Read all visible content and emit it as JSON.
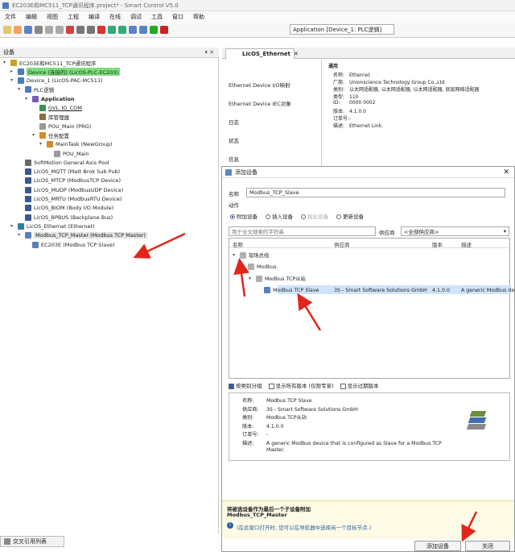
{
  "window": {
    "title": "EC203E和MC511_TCP通讯程序.project* - Smart Control V5.0"
  },
  "menu": [
    "文件",
    "编辑",
    "视图",
    "工程",
    "编译",
    "在线",
    "调试",
    "工具",
    "窗口",
    "帮助"
  ],
  "toolbar": {
    "application_select": "Application [Device_1: PLC逻辑]"
  },
  "left_panel": {
    "header": "设备",
    "bottom_tab": "交叉引用列表",
    "tree": [
      {
        "label": "EC203E和MC511_TCP通讯程序",
        "indent": 0,
        "icon": "project-icon",
        "exp": "▾"
      },
      {
        "label": "Device (连接的) (LicOS-PLC-EC203)",
        "indent": 1,
        "icon": "device-icon",
        "exp": "▸",
        "hl": "green"
      },
      {
        "label": "Device_1 (LicOS-PAC-MC511)",
        "indent": 1,
        "icon": "device-icon",
        "exp": "▾"
      },
      {
        "label": "PLC逻辑",
        "indent": 2,
        "icon": "plc-logic-icon",
        "exp": "▾"
      },
      {
        "label": "Application",
        "indent": 3,
        "icon": "application-icon",
        "exp": "▾",
        "bold": true
      },
      {
        "label": "GVL_IO_COM",
        "indent": 4,
        "icon": "gvl-icon",
        "exp": "",
        "underline": true
      },
      {
        "label": "库管理器",
        "indent": 4,
        "icon": "library-icon",
        "exp": ""
      },
      {
        "label": "POU_Main (PRG)",
        "indent": 4,
        "icon": "pou-icon",
        "exp": ""
      },
      {
        "label": "任务配置",
        "indent": 4,
        "icon": "task-config-icon",
        "exp": "▾"
      },
      {
        "label": "MainTask (NewGroup)",
        "indent": 5,
        "icon": "task-icon",
        "exp": "▾"
      },
      {
        "label": "POU_Main",
        "indent": 6,
        "icon": "pou-icon",
        "exp": ""
      },
      {
        "label": "SoftMotion General Axis Pool",
        "indent": 2,
        "icon": "axis-pool-icon",
        "exp": ""
      },
      {
        "label": "LicOS_MQTT (Matt Brok Sub Pub)",
        "indent": 2,
        "icon": "bus-icon",
        "exp": ""
      },
      {
        "label": "LicOS_MTCP (ModbusTCP Device)",
        "indent": 2,
        "icon": "bus-icon",
        "exp": ""
      },
      {
        "label": "LicOS_MUDP (ModbusUDP Device)",
        "indent": 2,
        "icon": "bus-icon",
        "exp": ""
      },
      {
        "label": "LicOS_MRTU (ModbusRTU Device)",
        "indent": 2,
        "icon": "bus-icon",
        "exp": ""
      },
      {
        "label": "LicOS_BIOM (Body I/O Module)",
        "indent": 2,
        "icon": "bus-icon",
        "exp": ""
      },
      {
        "label": "LicOS_BPBUS (Backplane Bus)",
        "indent": 2,
        "icon": "bus-icon",
        "exp": ""
      },
      {
        "label": "LicOS_Ethernet (Ethernet)",
        "indent": 1,
        "icon": "ethernet-icon",
        "exp": "▾"
      },
      {
        "label": "Modbus_TCP_Master (Modbus TCP Master)",
        "indent": 2,
        "icon": "modbus-master-icon",
        "exp": "▾",
        "hl": "sel"
      },
      {
        "label": "EC203E (Modbus TCP Slave)",
        "indent": 3,
        "icon": "modbus-slave-icon",
        "exp": ""
      }
    ]
  },
  "editor": {
    "tab_label": "LicOS_Ethernet",
    "side_menu": [
      "Ethernet Device I/O映射",
      "Ethernet Device IEC对象",
      "日志",
      "状态",
      "信息"
    ],
    "info_header": "通用",
    "info": [
      {
        "k": "名称:",
        "v": "Ethernet"
      },
      {
        "k": "厂商:",
        "v": "Unionscience Technology Group Co.,Ltd"
      },
      {
        "k": "类别:",
        "v": "以太网适配器, 以太网适配器, 以太网适配器, 底层网络适配器"
      },
      {
        "k": "类型:",
        "v": "110"
      },
      {
        "k": "ID:",
        "v": "0000 0002"
      },
      {
        "k": "版本:",
        "v": "4.1.0.0"
      },
      {
        "k": "订单号:",
        "v": "-"
      },
      {
        "k": "描述:",
        "v": "Ethernet Link."
      }
    ]
  },
  "dialog": {
    "title": "添加设备",
    "name_label": "名称",
    "name_value": "Modbus_TCP_Slave",
    "action_label": "动作",
    "actions": [
      {
        "label": "附加设备",
        "on": true
      },
      {
        "label": "插入设备",
        "on": false
      },
      {
        "label": "拔出设备",
        "on": false,
        "disabled": true
      },
      {
        "label": "更新设备",
        "on": false
      }
    ],
    "search_placeholder": "用于全文搜索的字符串",
    "vendor_label": "供应商",
    "vendor_value": "<全部供应商>",
    "columns": {
      "name": "名称",
      "vendor": "供应商",
      "version": "版本",
      "desc": "描述"
    },
    "tree": [
      {
        "label": "现场总线",
        "indent": 0,
        "exp": "▾"
      },
      {
        "label": "Modbus",
        "indent": 1,
        "exp": "▾"
      },
      {
        "label": "Modbus TCP从站",
        "indent": 2,
        "exp": "▾"
      },
      {
        "label": "Modbus TCP Slave",
        "indent": 3,
        "exp": "",
        "vendor": "3S - Smart Software Solutions GmbH",
        "version": "4.1.0.0",
        "desc": "A generic Modbus de"
      }
    ],
    "checks": [
      {
        "label": "按类别分组",
        "on": true
      },
      {
        "label": "显示所有版本 (仅限专家)",
        "on": false
      },
      {
        "label": "显示过期版本",
        "on": false
      }
    ],
    "detail": [
      {
        "k": "名称:",
        "v": "Modbus TCP Slave"
      },
      {
        "k": "供应商:",
        "v": "3S - Smart Software Solutions GmbH"
      },
      {
        "k": "类别:",
        "v": "Modbus TCP从站"
      },
      {
        "k": "版本:",
        "v": "4.1.0.0"
      },
      {
        "k": "订单号:",
        "v": "-"
      },
      {
        "k": "描述:",
        "v": "A generic Modbus device that is configured as Slave for a Modbus TCP"
      },
      {
        "k": "",
        "v": "Master."
      }
    ],
    "notice_title": "将被选设备作为最后一个子设备附加",
    "notice_device": "Modbus_TCP_Master",
    "notice_hint": "(在此窗口打开时, 您可以在导航器中选择另一个目标节点.)",
    "add_button": "添加设备",
    "close_button": "关闭"
  },
  "colors": {
    "highlight_green": "#7ee07e",
    "selection_blue": "#cde4fb",
    "annotation_red": "#e0261b"
  }
}
